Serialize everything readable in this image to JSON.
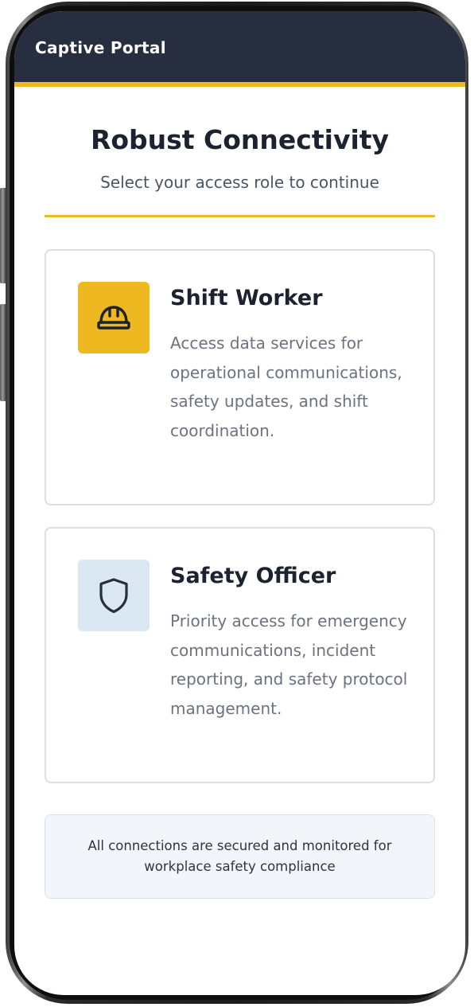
{
  "header": {
    "title": "Captive Portal"
  },
  "main": {
    "title": "Robust Connectivity",
    "subtitle": "Select your access role to continue"
  },
  "roles": [
    {
      "title": "Shift Worker",
      "description": "Access data services for operational communications, safety updates, and shift coordination.",
      "icon": "hard-hat-icon"
    },
    {
      "title": "Safety Officer",
      "description": "Priority access for emergency communications, incident reporting, and safety protocol management.",
      "icon": "shield-icon"
    }
  ],
  "notice": {
    "text": "All connections are secured and monitored for workplace safety compliance"
  },
  "colors": {
    "header_bg": "#272e3f",
    "accent": "#eeb920",
    "shield_tile": "#dbe7f2",
    "notice_bg": "#f2f6fa"
  }
}
